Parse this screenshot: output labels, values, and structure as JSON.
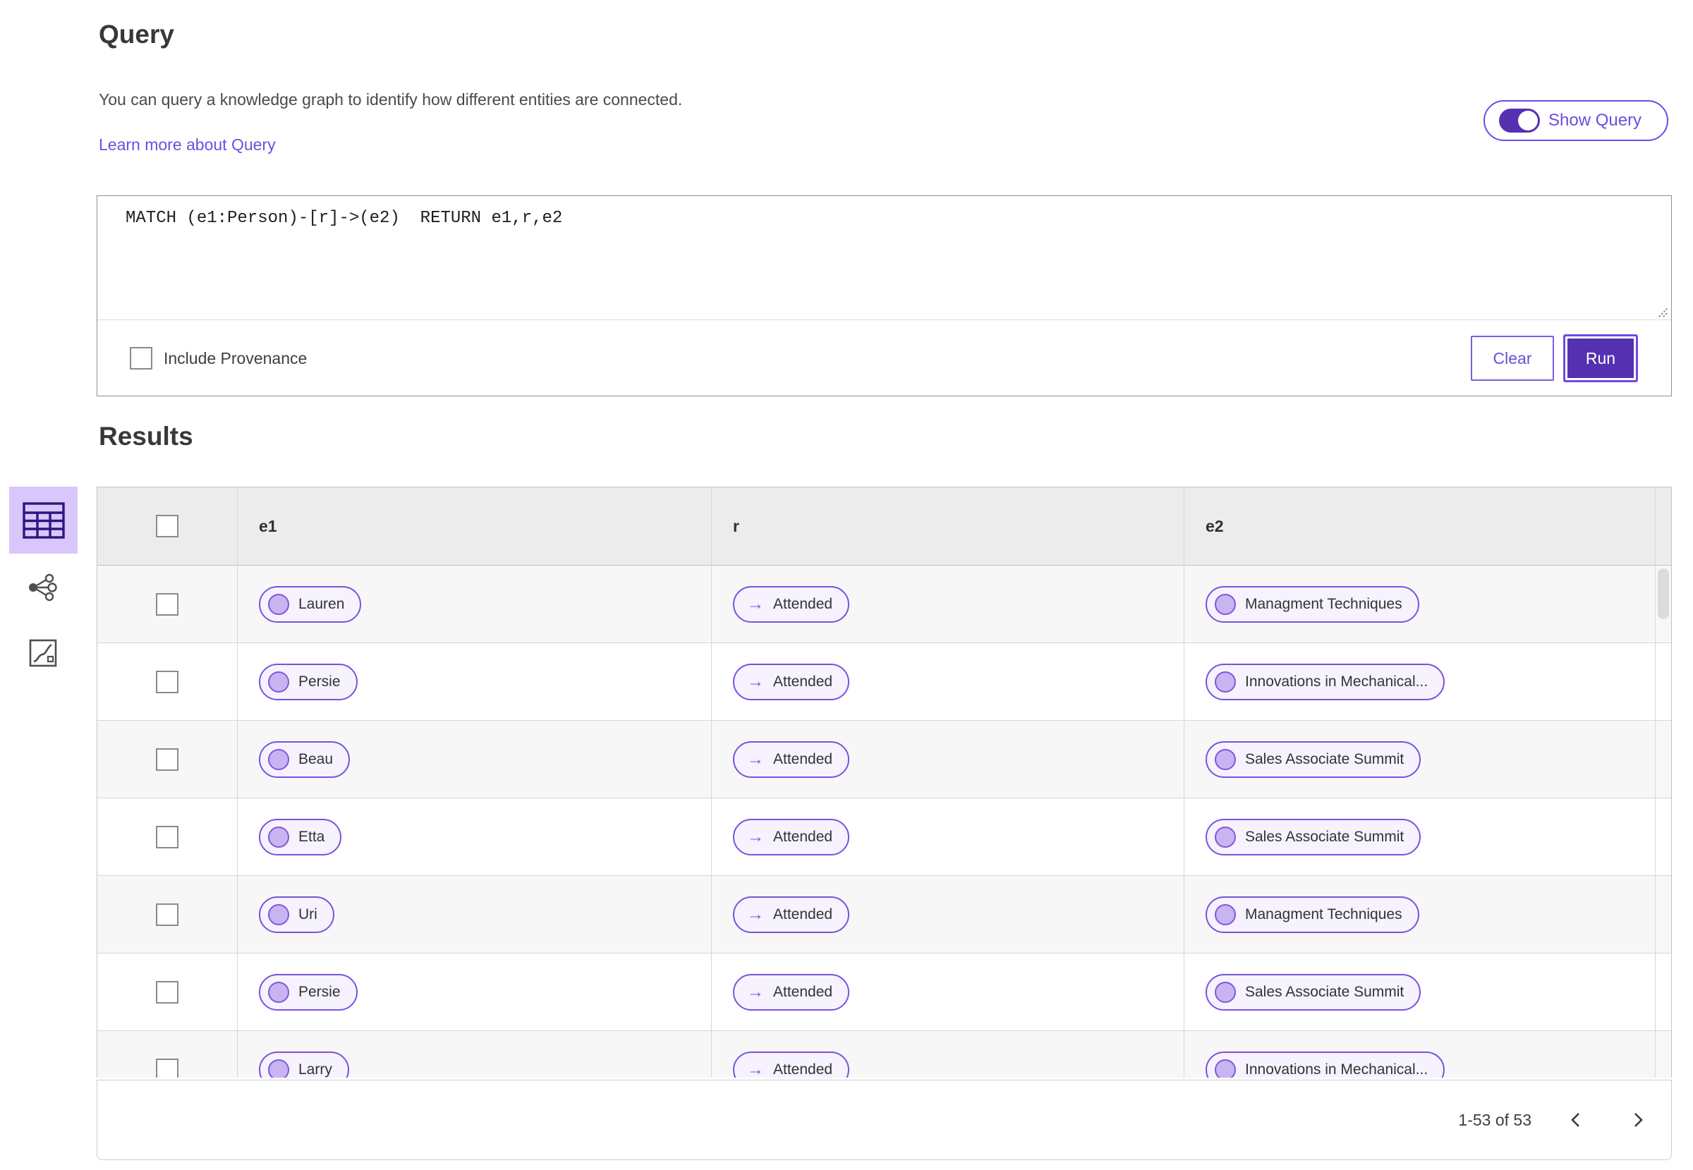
{
  "colors": {
    "accent": "#5531b2",
    "accent-light": "#6c4ce2",
    "link": "#6952dd",
    "pill-border": "#7a52dc",
    "pill-bg": "#f6f2fe",
    "dot-fill": "#c9b4f2",
    "dot-border": "#8157d8",
    "selected-tile": "#d9c7fb",
    "icon-dark": "#2d1580",
    "icon-gray": "#4f4f4f"
  },
  "icons": {
    "relation_arrow_glyph": "→",
    "view_switcher": [
      "table-view-icon",
      "graph-view-icon",
      "chart-view-icon"
    ]
  },
  "query_panel": {
    "title": "Query",
    "description": "You can query a knowledge graph to identify how different entities are connected.",
    "learn_more_label": "Learn more about Query",
    "show_query_label": "Show Query",
    "show_query_on": true,
    "query_text": "MATCH (e1:Person)-[r]->(e2)  RETURN e1,r,e2",
    "include_provenance_label": "Include Provenance",
    "include_provenance_checked": false,
    "clear_label": "Clear",
    "run_label": "Run"
  },
  "results": {
    "title": "Results",
    "views": [
      {
        "id": "table",
        "selected": true
      },
      {
        "id": "graph",
        "selected": false
      },
      {
        "id": "chart",
        "selected": false
      }
    ],
    "select_all_checked": false,
    "columns": [
      "e1",
      "r",
      "e2"
    ],
    "rows": [
      {
        "checked": false,
        "e1": "Lauren",
        "r": "Attended",
        "e2": "Managment Techniques"
      },
      {
        "checked": false,
        "e1": "Persie",
        "r": "Attended",
        "e2": "Innovations in Mechanical..."
      },
      {
        "checked": false,
        "e1": "Beau",
        "r": "Attended",
        "e2": "Sales Associate Summit"
      },
      {
        "checked": false,
        "e1": "Etta",
        "r": "Attended",
        "e2": "Sales Associate Summit"
      },
      {
        "checked": false,
        "e1": "Uri",
        "r": "Attended",
        "e2": "Managment Techniques"
      },
      {
        "checked": false,
        "e1": "Persie",
        "r": "Attended",
        "e2": "Sales Associate Summit"
      },
      {
        "checked": false,
        "e1": "Larry",
        "r": "Attended",
        "e2": "Innovations in Mechanical..."
      }
    ],
    "pagination": {
      "range_label": "1-53 of 53"
    }
  }
}
